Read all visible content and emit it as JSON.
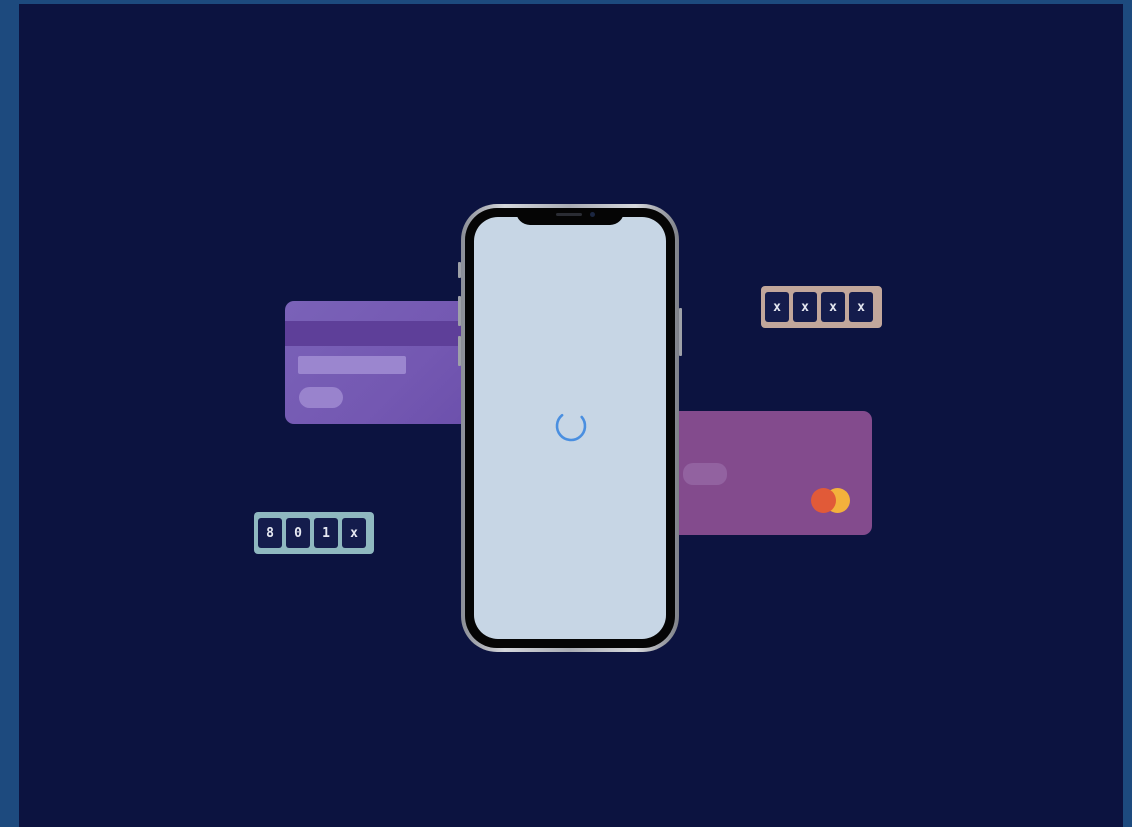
{
  "colors": {
    "frame": "#1d4a7e",
    "background": "#0c1340",
    "card_back": "#7458b2",
    "card_front": "#834b8d",
    "screen": "#c7d6e5",
    "spinner": "#4a8fe0",
    "pin_teal": "#8fb8c0",
    "pin_tan": "#c2a79b"
  },
  "pin_left": {
    "digits": [
      "8",
      "0",
      "1",
      "x"
    ]
  },
  "pin_right": {
    "digits": [
      "x",
      "x",
      "x",
      "x"
    ]
  },
  "icons": {
    "card_brand": "mastercard-logo-icon",
    "loader": "loading-spinner-icon"
  }
}
